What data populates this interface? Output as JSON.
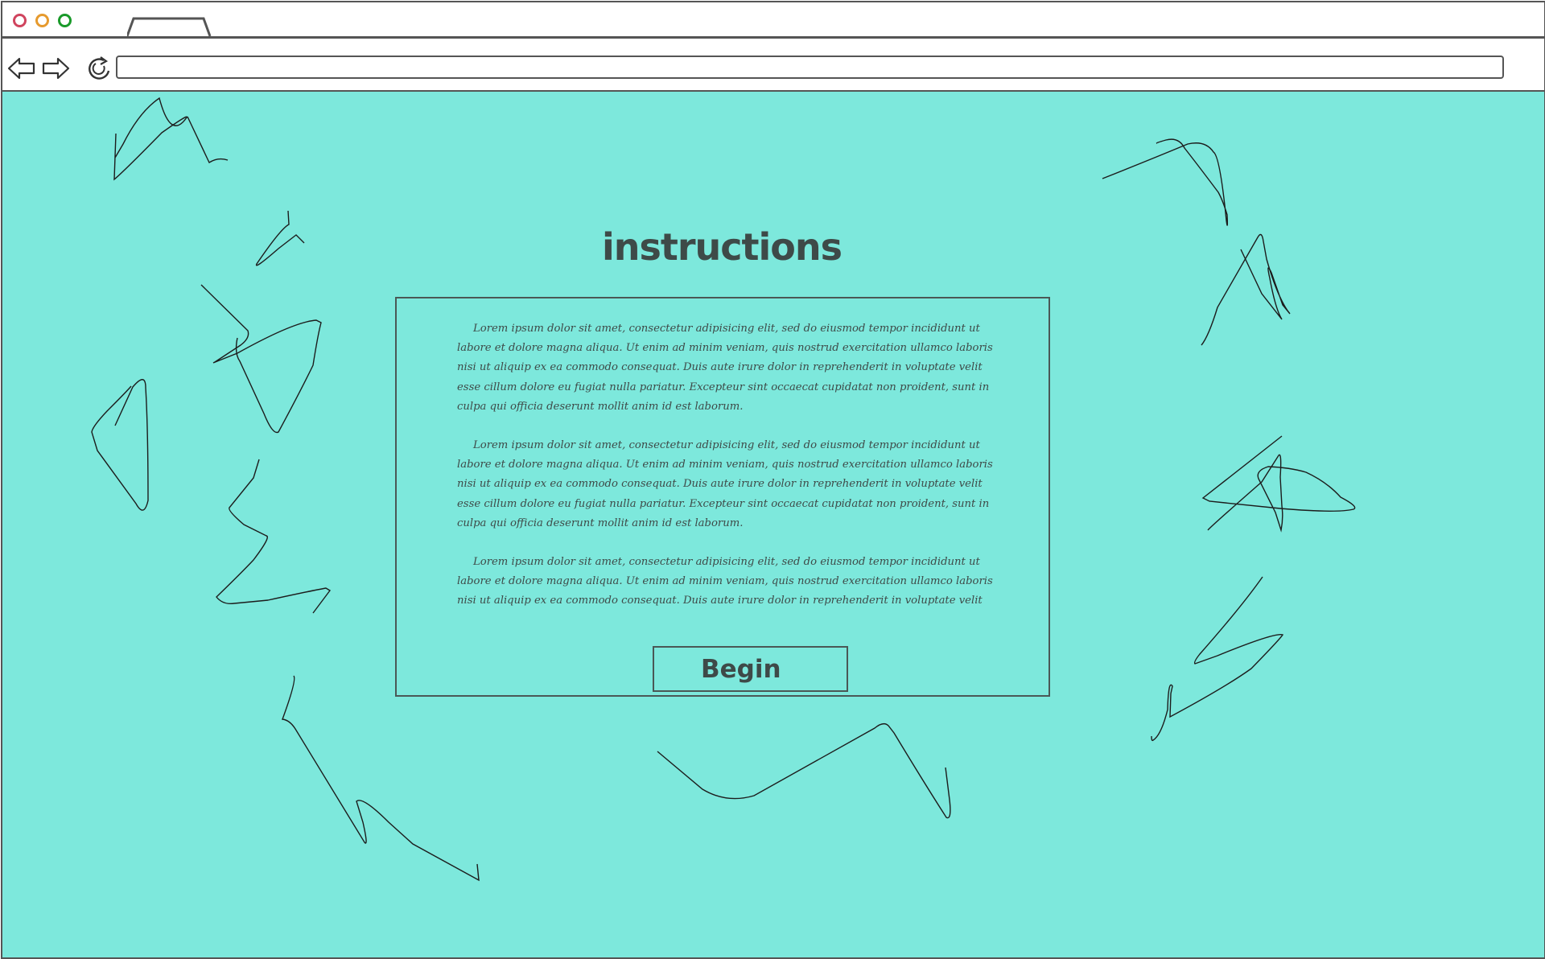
{
  "browser": {
    "address_value": "",
    "icons": [
      "back-arrow-icon",
      "forward-arrow-icon",
      "reload-icon"
    ],
    "window_controls": {
      "close_color": "#d0445e",
      "minimize_color": "#e69a2e",
      "maximize_color": "#1a9a2a"
    }
  },
  "page": {
    "background_color": "#7de8dc",
    "title": "instructions",
    "paragraphs": [
      "Lorem ipsum dolor sit amet, consectetur adipisicing elit, sed do eiusmod tempor incididunt ut labore et dolore magna aliqua. Ut enim ad minim veniam, quis nostrud exercitation ullamco laboris nisi ut aliquip ex ea commodo consequat. Duis aute irure dolor in reprehenderit in voluptate velit esse cillum dolore eu fugiat nulla pariatur. Excepteur sint occaecat cupidatat non proident, sunt in culpa qui officia deserunt mollit anim id est laborum.",
      "Lorem ipsum dolor sit amet, consectetur adipisicing elit, sed do eiusmod tempor incididunt ut labore et dolore magna aliqua. Ut enim ad minim veniam, quis nostrud exercitation ullamco laboris nisi ut aliquip ex ea commodo consequat. Duis aute irure dolor in reprehenderit in voluptate velit esse cillum dolore eu fugiat nulla pariatur. Excepteur sint occaecat cupidatat non proident, sunt in culpa qui officia deserunt mollit anim id est laborum.",
      "Lorem ipsum dolor sit amet, consectetur adipisicing elit, sed do eiusmod tempor incididunt ut labore et dolore magna aliqua. Ut enim ad minim veniam, quis nostrud exercitation ullamco laboris nisi ut aliquip ex ea commodo consequat. Duis aute irure dolor in reprehenderit in voluptate velit esse cillum dolore eu fugiat"
    ],
    "begin_label": "Begin"
  }
}
